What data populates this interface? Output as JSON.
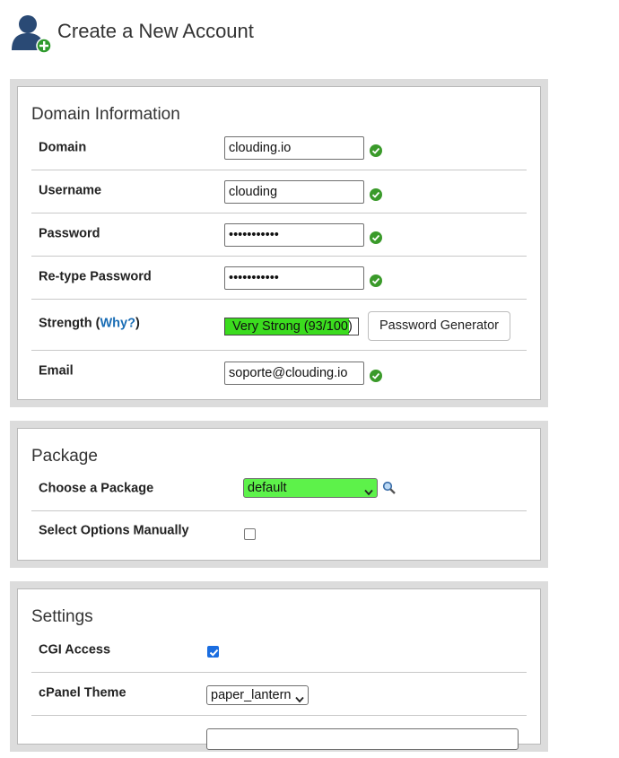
{
  "page": {
    "title": "Create a New Account"
  },
  "domain_info": {
    "title": "Domain Information",
    "domain": {
      "label": "Domain",
      "value": "clouding.io"
    },
    "username": {
      "label": "Username",
      "value": "clouding"
    },
    "password": {
      "label": "Password",
      "value": "•••••••••••"
    },
    "retype": {
      "label": "Re-type Password",
      "value": "•••••••••••"
    },
    "strength": {
      "label_pre": "Strength (",
      "link": "Why?",
      "label_post": ")",
      "text": "Very Strong (93/100)",
      "score": 93,
      "fill_color": "#3bdc1e"
    },
    "generator_button": "Password Generator",
    "email": {
      "label": "Email",
      "value": "soporte@clouding.io"
    }
  },
  "package": {
    "title": "Package",
    "choose": {
      "label": "Choose a Package",
      "value": "default",
      "highlight": "#5df24a"
    },
    "manual": {
      "label": "Select Options Manually",
      "checked": false
    }
  },
  "settings": {
    "title": "Settings",
    "cgi": {
      "label": "CGI Access",
      "checked": true
    },
    "theme": {
      "label": "cPanel Theme",
      "value": "paper_lantern"
    }
  },
  "colors": {
    "accent": "#1a6db5",
    "success": "#3a9a2a",
    "panel_bg": "#dcdcdc"
  }
}
